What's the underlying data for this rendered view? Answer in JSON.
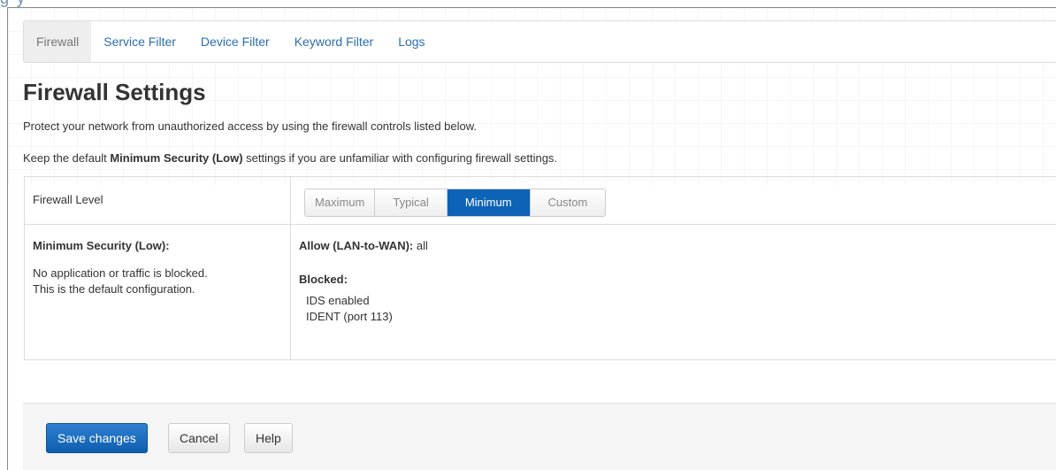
{
  "tabs": [
    {
      "label": "Firewall",
      "active": true
    },
    {
      "label": "Service Filter",
      "active": false
    },
    {
      "label": "Device Filter",
      "active": false
    },
    {
      "label": "Keyword Filter",
      "active": false
    },
    {
      "label": "Logs",
      "active": false
    }
  ],
  "page": {
    "title": "Firewall Settings",
    "description": "Protect your network from unauthorized access by using the firewall controls listed below.",
    "note_prefix": "Keep the default ",
    "note_bold": "Minimum Security (Low)",
    "note_suffix": " settings if you are unfamiliar with configuring firewall settings."
  },
  "firewall_level": {
    "label": "Firewall Level",
    "options": [
      "Maximum",
      "Typical",
      "Minimum",
      "Custom"
    ],
    "selected": "Minimum"
  },
  "security": {
    "title": "Minimum Security (Low):",
    "desc_line1": "No application or traffic is blocked.",
    "desc_line2": "This is the default configuration.",
    "allow_label": "Allow (LAN-to-WAN):",
    "allow_value": " all",
    "blocked_label": "Blocked:",
    "blocked_items": [
      "IDS enabled",
      "IDENT (port 113)"
    ]
  },
  "footer": {
    "save_label": "Save changes",
    "cancel_label": "Cancel",
    "help_label": "Help"
  },
  "colors": {
    "accent": "#0d63b6",
    "link": "#2a6db2"
  }
}
